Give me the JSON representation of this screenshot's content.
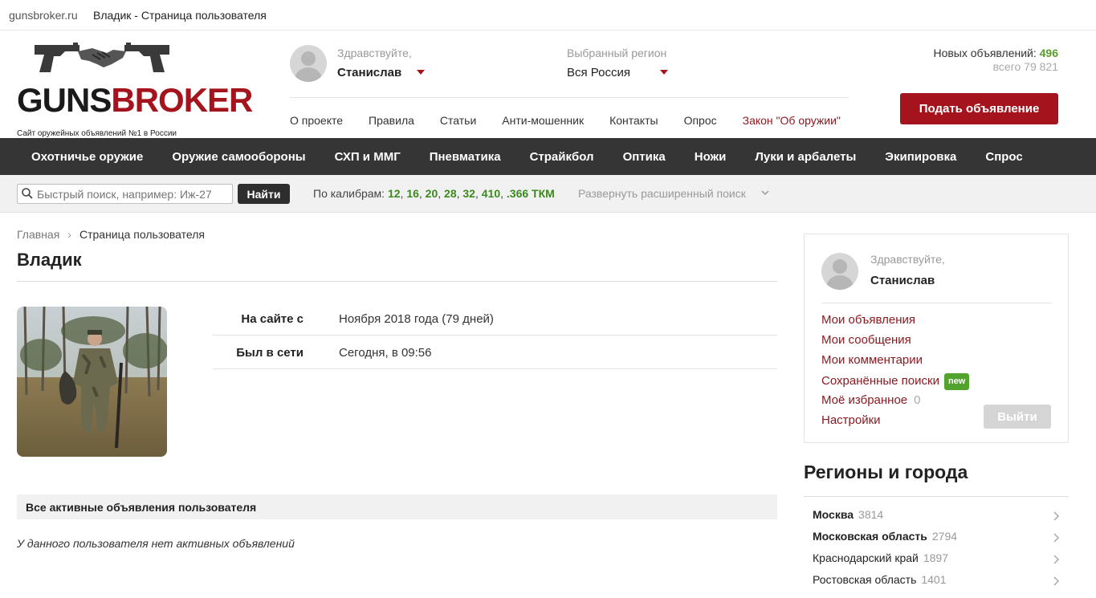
{
  "browser": {
    "domain": "gunsbroker.ru",
    "title": "Владик - Страница пользователя"
  },
  "header": {
    "logo": {
      "word_part1": "GUNS",
      "word_part2": "BROKER",
      "tagline": "Сайт оружейных объявлений №1 в России"
    },
    "greeting_label": "Здравствуйте,",
    "user_name": "Станислав",
    "region_label": "Выбранный регион",
    "region_value": "Вся Россия",
    "nav": [
      "О проекте",
      "Правила",
      "Статьи",
      "Анти-мошенник",
      "Контакты",
      "Опрос",
      "Закон \"Об оружии\""
    ],
    "stats": {
      "new_label": "Новых объявлений:",
      "new_count": "496",
      "total": "всего 79 821"
    },
    "post_button": "Подать объявление"
  },
  "categories": [
    "Охотничье оружие",
    "Оружие самообороны",
    "СХП и ММГ",
    "Пневматика",
    "Страйкбол",
    "Оптика",
    "Ножи",
    "Луки и арбалеты",
    "Экипировка",
    "Спрос"
  ],
  "search": {
    "placeholder": "Быстрый поиск, например: Иж-27",
    "button": "Найти",
    "calibers_label": "По калибрам:",
    "calibers": [
      "12",
      "16",
      "20",
      "28",
      "32",
      "410",
      ".366 ТКМ"
    ],
    "expand_label": "Развернуть расширенный поиск"
  },
  "main": {
    "breadcrumb": {
      "home": "Главная",
      "current": "Страница пользователя"
    },
    "title": "Владик",
    "info": [
      {
        "key": "На сайте с",
        "value": "Ноября 2018 года (79 дней)"
      },
      {
        "key": "Был в сети",
        "value": "Сегодня, в 09:56"
      }
    ],
    "active_header": "Все активные объявления пользователя",
    "no_ads": "У данного пользователя нет активных объявлений"
  },
  "sidebar": {
    "greeting_label": "Здравствуйте,",
    "user_name": "Станислав",
    "menu": {
      "my_ads": "Мои объявления",
      "my_messages": "Мои сообщения",
      "my_comments": "Мои комментарии",
      "saved_searches": "Сохранённые поиски",
      "saved_badge": "new",
      "favorites": "Моё избранное",
      "favorites_count": "0",
      "settings": "Настройки"
    },
    "logout": "Выйти",
    "regions_title": "Регионы и города",
    "regions": [
      {
        "name": "Москва",
        "count": "3814",
        "bold": true
      },
      {
        "name": "Московская область",
        "count": "2794",
        "bold": true
      },
      {
        "name": "Краснодарский край",
        "count": "1897",
        "bold": false
      },
      {
        "name": "Ростовская область",
        "count": "1401",
        "bold": false
      }
    ]
  },
  "colors": {
    "brand_red": "#a5141d",
    "nav_dark": "#353535",
    "accent_green": "#52a32e"
  }
}
